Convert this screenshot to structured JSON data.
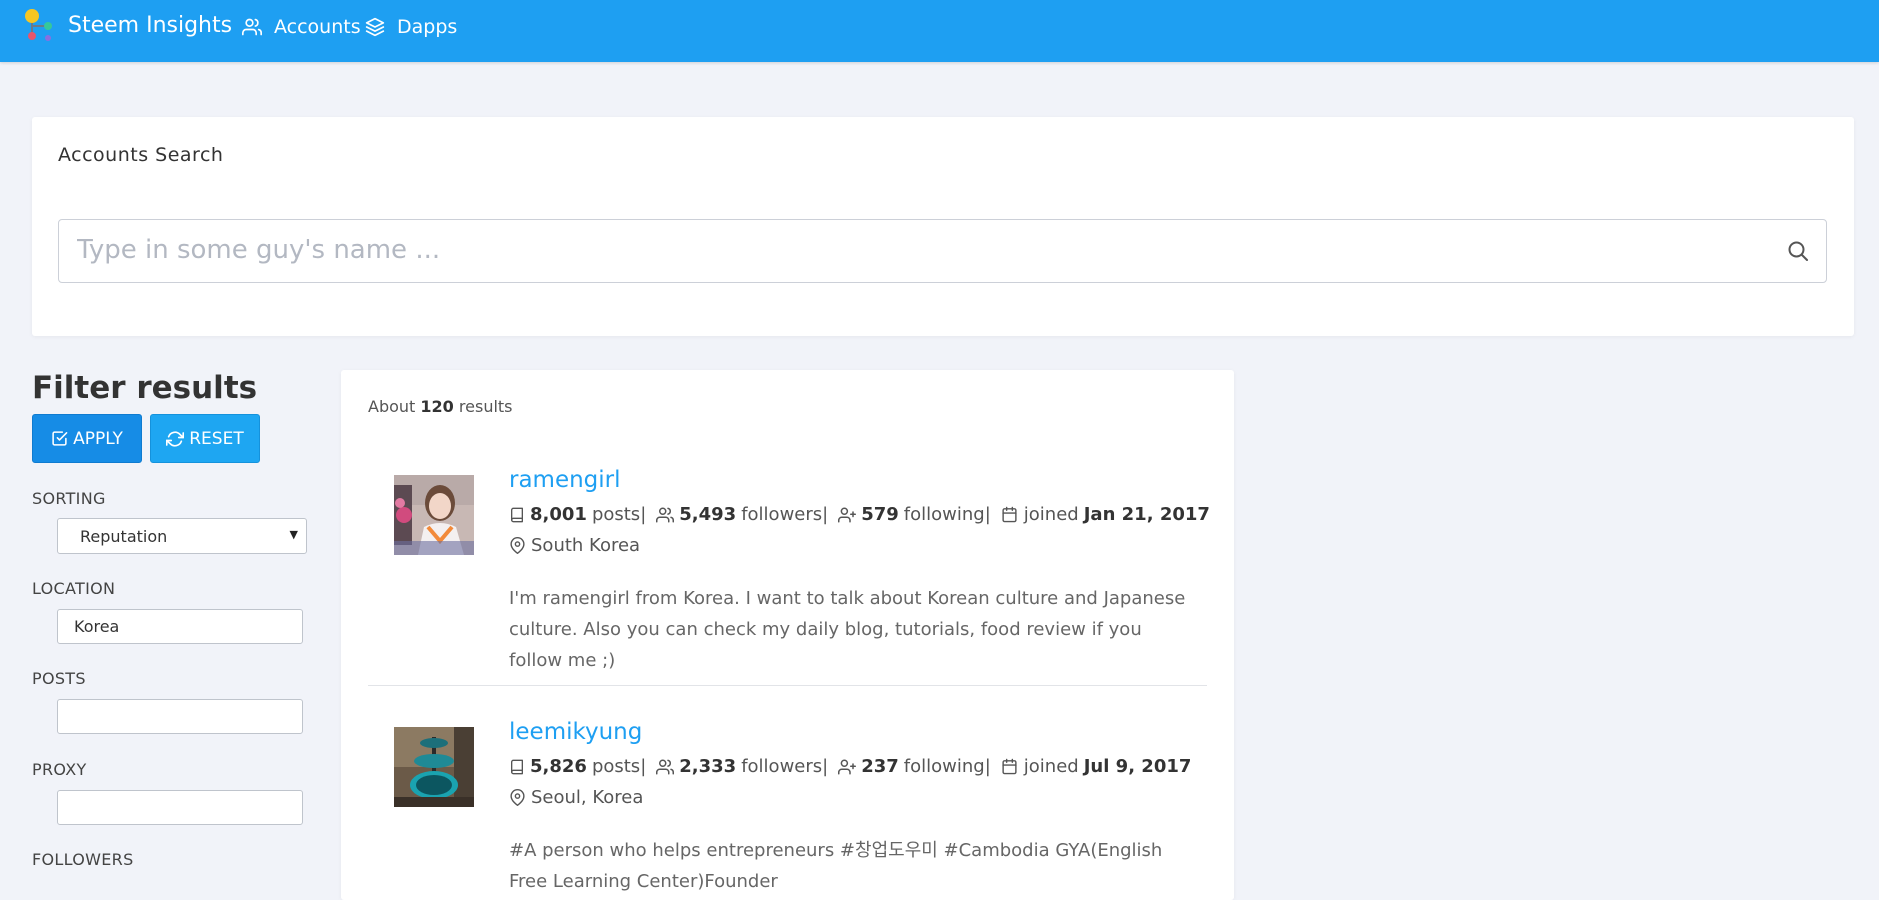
{
  "app": {
    "name": "Steem Insights"
  },
  "nav": [
    {
      "label": "Accounts",
      "icon": "users-icon"
    },
    {
      "label": "Dapps",
      "icon": "layers-icon"
    }
  ],
  "search": {
    "title": "Accounts Search",
    "placeholder": "Type in some guy's name ..."
  },
  "filters": {
    "title": "Filter results",
    "apply_label": "APPLY",
    "reset_label": "RESET",
    "sorting_label": "SORTING",
    "sorting_value": "Reputation",
    "location_label": "LOCATION",
    "location_value": "Korea",
    "posts_label": "POSTS",
    "posts_value": "",
    "proxy_label": "PROXY",
    "proxy_value": "",
    "followers_label": "FOLLOWERS"
  },
  "results": {
    "prefix": "About",
    "count": "120",
    "suffix": "results",
    "items": [
      {
        "name": "ramengirl",
        "posts": "8,001",
        "followers": "5,493",
        "following": "579",
        "joined": "Jan 21, 2017",
        "location": "South Korea",
        "about": "I'm ramengirl from Korea. I want to talk about Korean culture and Japanese culture. Also you can check my daily blog, tutorials, food review if you follow me ;)"
      },
      {
        "name": "leemikyung",
        "posts": "5,826",
        "followers": "2,333",
        "following": "237",
        "joined": "Jul 9, 2017",
        "location": "Seoul, Korea",
        "about": "#A person who helps entrepreneurs #창업도우미 #Cambodia GYA(English Free Learning Center)Founder"
      }
    ],
    "labels": {
      "posts": "posts|",
      "followers": "followers|",
      "following": "following|",
      "joined": "joined"
    }
  },
  "colors": {
    "primary": "#1e9ff2",
    "background": "#f1f3f9"
  }
}
